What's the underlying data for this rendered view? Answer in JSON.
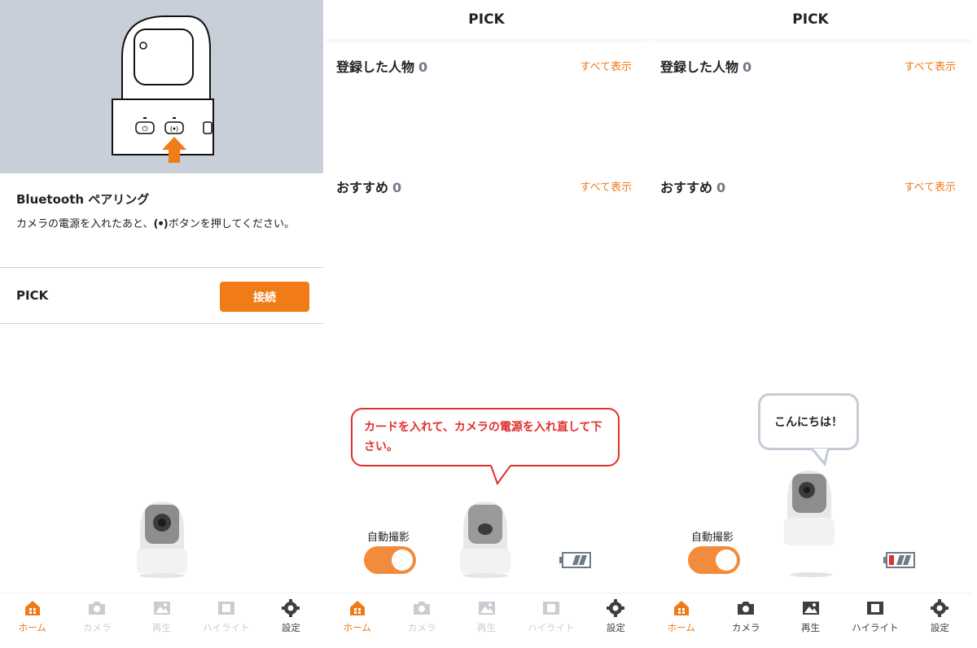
{
  "panel1": {
    "bt_title": "Bluetooth ペアリング",
    "bt_desc_1": "カメラの電源を入れたあと、",
    "bt_radio": "(ꔷ)",
    "bt_desc_2": "ボタンを押してください。",
    "pick_label": "PICK",
    "connect_label": "接続"
  },
  "panel2": {
    "header": "PICK",
    "registered_label": "登録した人物",
    "registered_count": "0",
    "recommended_label": "おすすめ",
    "recommended_count": "0",
    "see_all": "すべて表示",
    "bubble": "カードを入れて、カメラの電源を入れ直して下さい。",
    "auto_label": "自動撮影"
  },
  "panel3": {
    "header": "PICK",
    "registered_label": "登録した人物",
    "registered_count": "0",
    "recommended_label": "おすすめ",
    "recommended_count": "0",
    "see_all": "すべて表示",
    "bubble": "こんにちは！",
    "auto_label": "自動撮影"
  },
  "tabs": {
    "home": "ホーム",
    "camera": "カメラ",
    "play": "再生",
    "highlight": "ハイライト",
    "settings": "設定"
  },
  "colors": {
    "accent": "#ef7a1a",
    "alert": "#e0302c",
    "inactive": "#c9cdd2"
  }
}
